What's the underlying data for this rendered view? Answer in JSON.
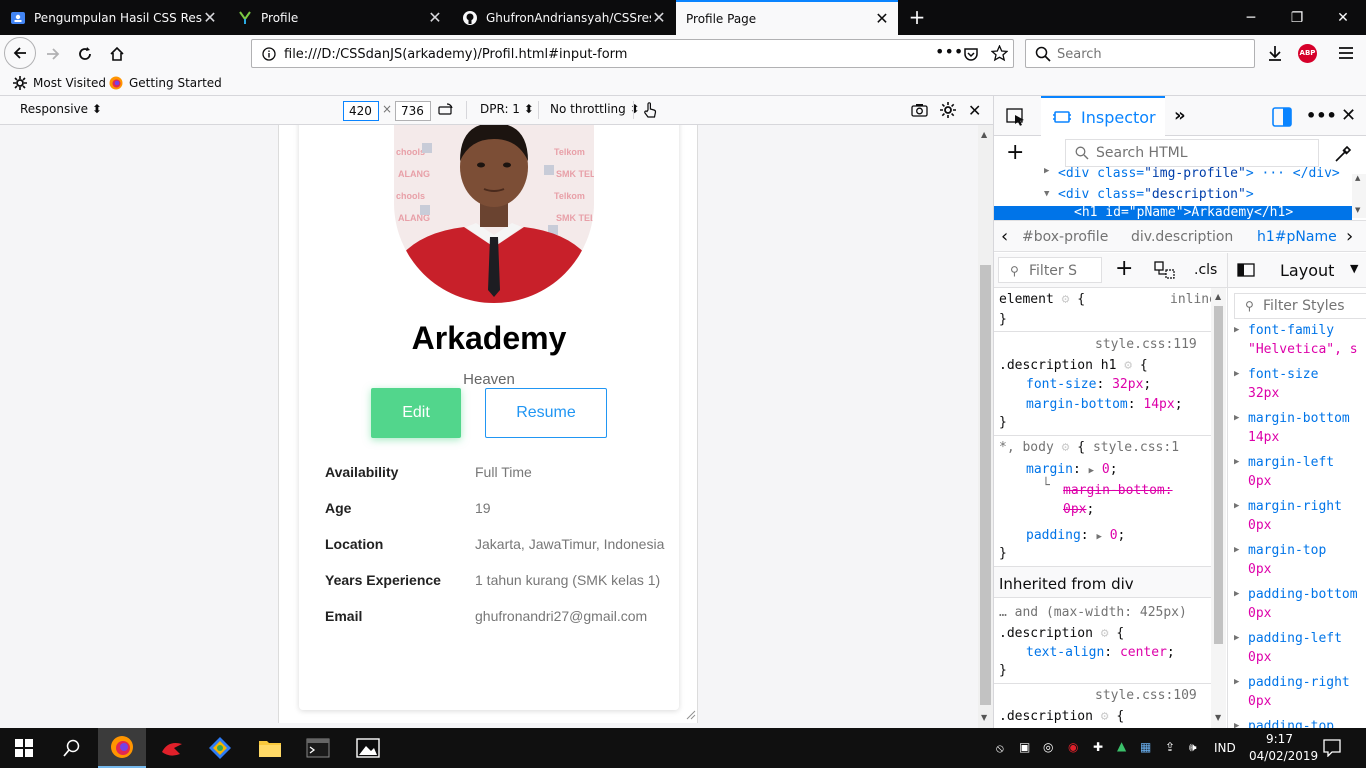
{
  "browser": {
    "tabs": [
      {
        "title": "Pengumpulan Hasil CSS Respo",
        "icon": "classroom-icon"
      },
      {
        "title": "Profile",
        "icon": "profile-app-icon"
      },
      {
        "title": "GhufronAndriansyah/CSSrespo",
        "icon": "github-icon"
      },
      {
        "title": "Profile Page",
        "icon": "page-icon"
      }
    ],
    "url": "file:///D:/CSSdanJS(arkademy)/Profil.html#input-form",
    "search_placeholder": "Search",
    "bookmarks": [
      {
        "label": "Most Visited",
        "icon": "gear-icon"
      },
      {
        "label": "Getting Started",
        "icon": "firefox-icon"
      }
    ],
    "abp_label": "ABP"
  },
  "rdm": {
    "device": "Responsive",
    "width": "420",
    "times": "×",
    "height": "736",
    "dpr": "DPR: 1",
    "throttling": "No throttling"
  },
  "profile": {
    "name": "Arkademy",
    "title": "Heaven",
    "edit_label": "Edit",
    "resume_label": "Resume",
    "details": [
      {
        "key": "Availability",
        "value": "Full Time"
      },
      {
        "key": "Age",
        "value": "19"
      },
      {
        "key": "Location",
        "value": "Jakarta, JawaTimur, Indonesia"
      },
      {
        "key": "Years Experience",
        "value": "1 tahun kurang (SMK kelas 1)"
      },
      {
        "key": "Email",
        "value": "ghufronandri27@gmail.com"
      }
    ]
  },
  "devtools": {
    "inspector_label": "Inspector",
    "search_html": "Search HTML",
    "markup": {
      "line1_tag": "<div class=",
      "line1_val": "\"img-profile\"",
      "line1_end": "> ··· </div>",
      "line2_tag": "<div class=",
      "line2_val": "\"description\"",
      "line2_end": ">",
      "line3": "<h1 id=\"pName\">Arkademy</h1>"
    },
    "breadcrumbs": [
      "#box-profile",
      "div.description",
      "h1#pName"
    ],
    "filter_styles": "Filter S",
    "cls_label": ".cls",
    "layout_label": "Layout",
    "filter_styles_right": "Filter Styles",
    "rules": {
      "element": "element",
      "element_brace": "{",
      "inline": "inline",
      "close": "}",
      "src1": "style.css:119",
      "sel1": ".description h1",
      "p1a": "font-size",
      "v1a": "32px",
      "p1b": "margin-bottom",
      "v1b": "14px",
      "sel2": "*, body",
      "src2": "style.css:1",
      "p2a": "margin",
      "v2a": "0",
      "p2sub": "margin-bottom:",
      "v2sub": "0px",
      "p2b": "padding",
      "v2b": "0",
      "inherited": "Inherited from div",
      "media": "… and (max-width: 425px)",
      "sel3": ".description",
      "p3a": "text-align",
      "v3a": "center",
      "src4": "style.css:109",
      "sel4": ".description"
    },
    "computed": [
      {
        "prop": "font-family",
        "val": "\"Helvetica\", s"
      },
      {
        "prop": "font-size",
        "val": "32px"
      },
      {
        "prop": "margin-bottom",
        "val": "14px"
      },
      {
        "prop": "margin-left",
        "val": "0px"
      },
      {
        "prop": "margin-right",
        "val": "0px"
      },
      {
        "prop": "margin-top",
        "val": "0px"
      },
      {
        "prop": "padding-bottom",
        "val": "0px"
      },
      {
        "prop": "padding-left",
        "val": "0px"
      },
      {
        "prop": "padding-right",
        "val": "0px"
      },
      {
        "prop": "padding-top",
        "val": ""
      }
    ]
  },
  "taskbar": {
    "language": "IND",
    "time": "9:17",
    "date": "04/02/2019"
  },
  "colors": {
    "accent": "#0a84ff",
    "edit_button": "#52d68c",
    "resume_button": "#2196f3"
  }
}
